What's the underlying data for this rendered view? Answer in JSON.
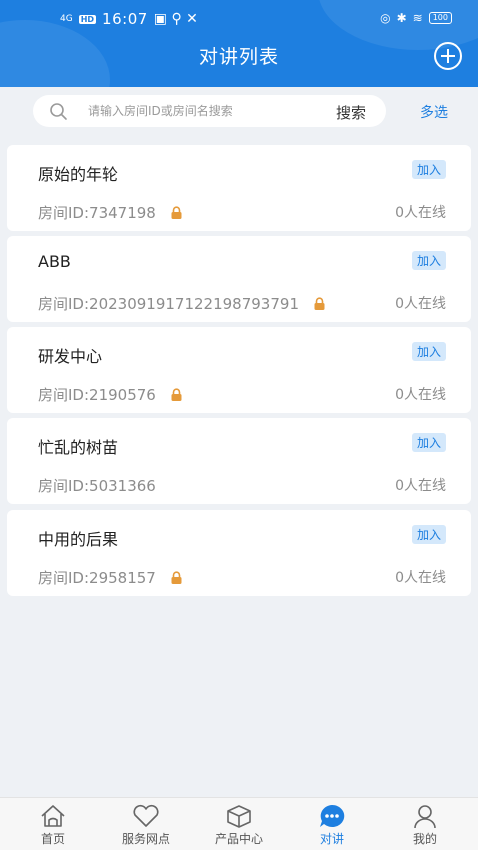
{
  "status_bar": {
    "signal": "4G",
    "hd": "HD",
    "time": "16:07",
    "battery": "100"
  },
  "header": {
    "title": "对讲列表"
  },
  "search": {
    "placeholder": "请输入房间ID或房间名搜索",
    "button_label": "搜索",
    "multi_select_label": "多选"
  },
  "rooms": [
    {
      "name": "原始的年轮",
      "id_text": "房间ID:7347198",
      "locked": true,
      "join_label": "加入",
      "online_text": "0人在线"
    },
    {
      "name": "ABB",
      "id_text": "房间ID:20230919171221987937​91",
      "locked": true,
      "join_label": "加入",
      "online_text": "0人在线"
    },
    {
      "name": "研发中心",
      "id_text": "房间ID:2190576",
      "locked": true,
      "join_label": "加入",
      "online_text": "0人在线"
    },
    {
      "name": "忙乱的树苗",
      "id_text": "房间ID:5031366",
      "locked": false,
      "join_label": "加入",
      "online_text": "0人在线"
    },
    {
      "name": "中用的后果",
      "id_text": "房间ID:2958157",
      "locked": true,
      "join_label": "加入",
      "online_text": "0人在线"
    }
  ],
  "tabbar": {
    "tabs": [
      {
        "label": "首页",
        "icon": "home-icon",
        "active": false
      },
      {
        "label": "服务网点",
        "icon": "heart-icon",
        "active": false
      },
      {
        "label": "产品中心",
        "icon": "box-icon",
        "active": false
      },
      {
        "label": "对讲",
        "icon": "chat-icon",
        "active": true
      },
      {
        "label": "我的",
        "icon": "user-icon",
        "active": false
      }
    ]
  },
  "colors": {
    "primary": "#1e7fe0",
    "lock": "#e59a3a",
    "badge_bg": "#d4e8fb"
  }
}
